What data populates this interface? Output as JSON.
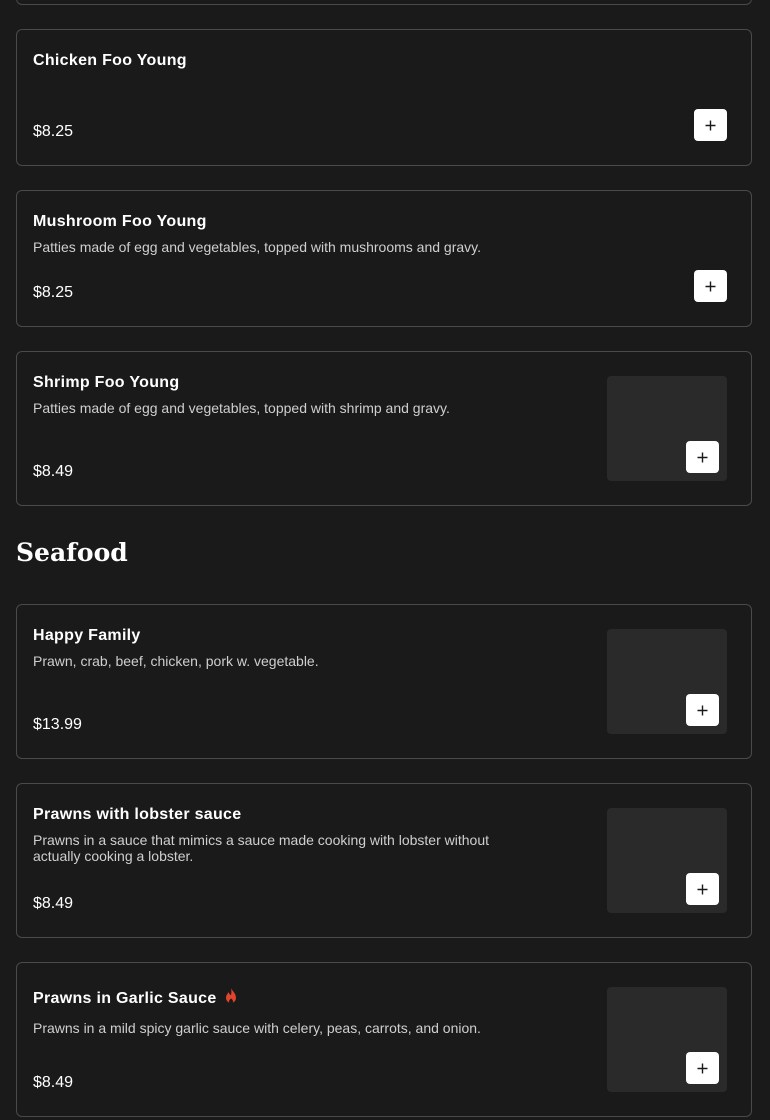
{
  "sections": [
    {
      "items": [
        {
          "name": "Chicken Foo Young",
          "description": "",
          "price": "$8.25",
          "add_label": "+"
        },
        {
          "name": "Mushroom Foo Young",
          "description": "Patties made of egg and vegetables, topped with mushrooms and gravy.",
          "price": "$8.25",
          "add_label": "+"
        },
        {
          "name": "Shrimp Foo Young",
          "description": "Patties made of egg and vegetables, topped with shrimp and gravy.",
          "price": "$8.49",
          "add_label": "+"
        }
      ]
    },
    {
      "title": "Seafood",
      "items": [
        {
          "name": "Happy Family",
          "description": "Prawn, crab, beef, chicken, pork w. vegetable.",
          "price": "$13.99",
          "add_label": "+"
        },
        {
          "name": "Prawns with lobster sauce",
          "description": "Prawns in a sauce that mimics a sauce made cooking with lobster without actually cooking a lobster.",
          "price": "$8.49",
          "add_label": "+"
        },
        {
          "name": "Prawns in Garlic Sauce",
          "description": "Prawns in a mild spicy garlic sauce with celery, peas, carrots, and onion.",
          "price": "$8.49",
          "add_label": "+",
          "badge_icon": "spicy-flame-icon"
        }
      ]
    }
  ],
  "colors": {
    "background": "#1b1a1a",
    "card_border": "#4a4a4a",
    "thumbnail": "#2a2a2a",
    "spicy": "#e0442c"
  }
}
